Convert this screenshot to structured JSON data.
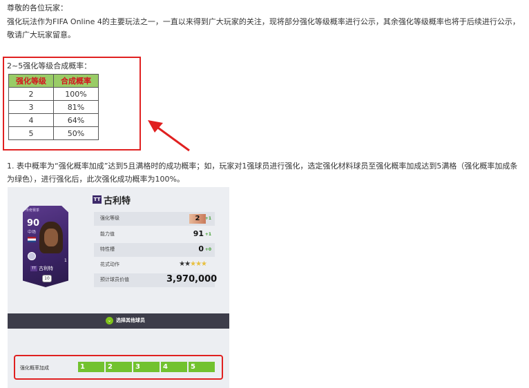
{
  "text": {
    "greeting": "尊敬的各位玩家：",
    "intro": "强化玩法作为FIFA Online 4的主要玩法之一，一直以来得到广大玩家的关注，现将部分强化等级概率进行公示，其余强化等级概率也将于后续进行公示，敬请广大玩家留意。",
    "table_caption": "2~5强化等级合成概率：",
    "note": "1. 表中概率为“强化概率加成”达到5且满格时的成功概率；如，玩家对1强球员进行强化，选定强化材料球员至强化概率加成达到5满格（强化概率加成条为绿色），进行强化后，此次强化成功概率为100%。"
  },
  "table": {
    "headers": [
      "强化等级",
      "合成概率"
    ],
    "rows": [
      [
        "2",
        "100%"
      ],
      [
        "3",
        "81%"
      ],
      [
        "4",
        "64%"
      ],
      [
        "5",
        "50%"
      ]
    ]
  },
  "game": {
    "card": {
      "top_text": "传奇赛季",
      "rating": "90",
      "position": "中场",
      "badge": "TT",
      "name": "古利特",
      "number": "1",
      "level": "10"
    },
    "player_badge": "TT",
    "player_name": "古利特",
    "stats": {
      "level_label": "强化等级",
      "level_value": "2",
      "level_plus": "+1",
      "ability_label": "能力值",
      "ability_value": "91",
      "ability_plus": "+1",
      "trait_label": "特性槽",
      "trait_value": "0",
      "trait_plus": "+0",
      "skill_label": "花式动作",
      "skill_stars_filled": 2,
      "skill_stars_total": 5,
      "price_label": "预计球员价值",
      "price_value": "3,970,000"
    },
    "select_other": "选择其他球员",
    "bonus_label": "强化概率加成",
    "bonus_segments": [
      "1",
      "2",
      "3",
      "4",
      "5"
    ]
  },
  "colors": {
    "highlight": "#e02020",
    "table_header_bg": "#99cc66",
    "table_header_text": "#d4141e",
    "bonus_green": "#72c22f"
  }
}
